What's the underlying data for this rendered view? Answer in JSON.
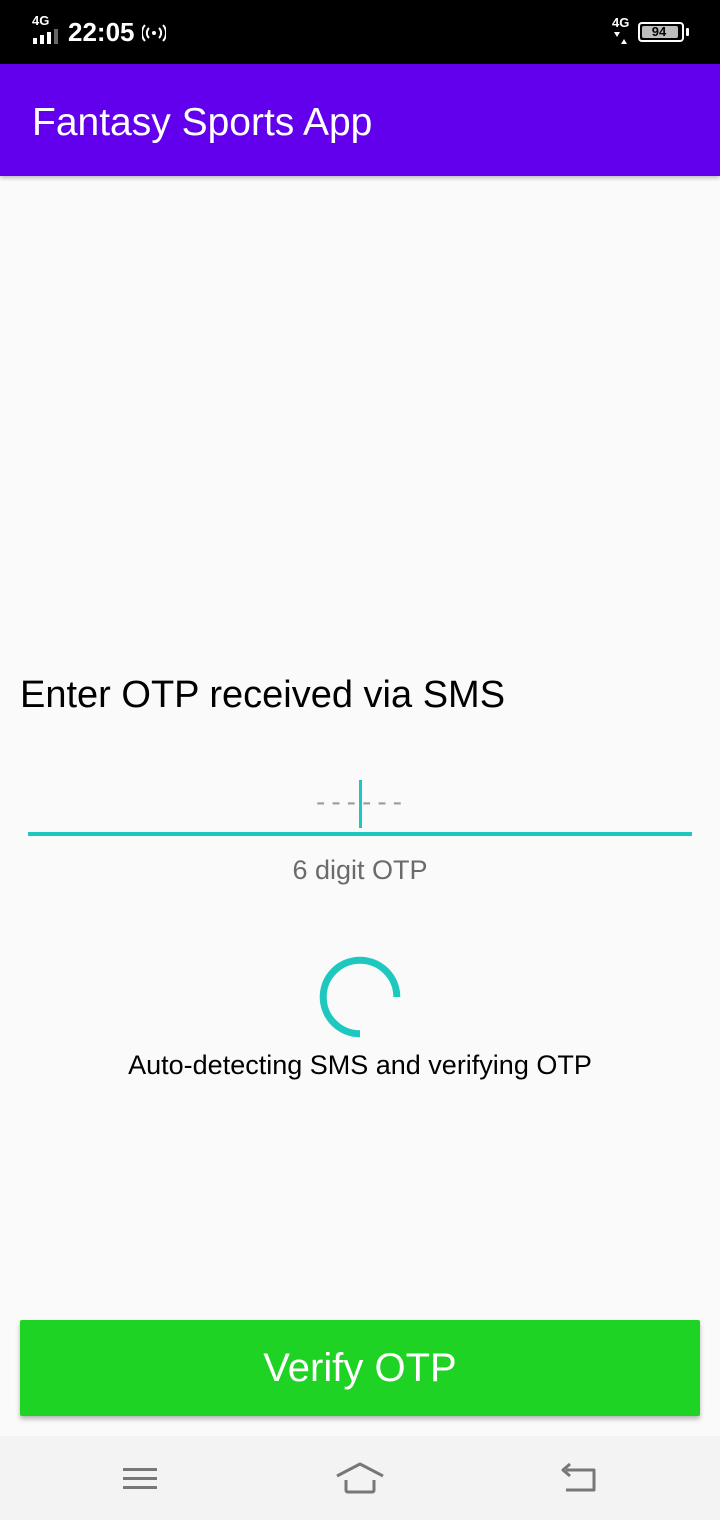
{
  "status_bar": {
    "network_left": "4G",
    "time": "22:05",
    "network_right": "4G",
    "battery_level": "94",
    "icons": [
      "signal-icon",
      "hotspot-icon",
      "data-arrows-icon",
      "battery-icon"
    ]
  },
  "app_bar": {
    "title": "Fantasy Sports App",
    "color": "#6200ee"
  },
  "otp": {
    "heading": "Enter OTP received via SMS",
    "placeholder": "------",
    "value": "",
    "hint": "6 digit OTP",
    "accent_color": "#1ec8be"
  },
  "status": {
    "message": "Auto-detecting SMS and verifying OTP"
  },
  "verify_button": {
    "label": "Verify OTP",
    "color": "#1ed323"
  },
  "nav_bar": {
    "icons": [
      "menu-icon",
      "home-icon",
      "back-icon"
    ]
  }
}
